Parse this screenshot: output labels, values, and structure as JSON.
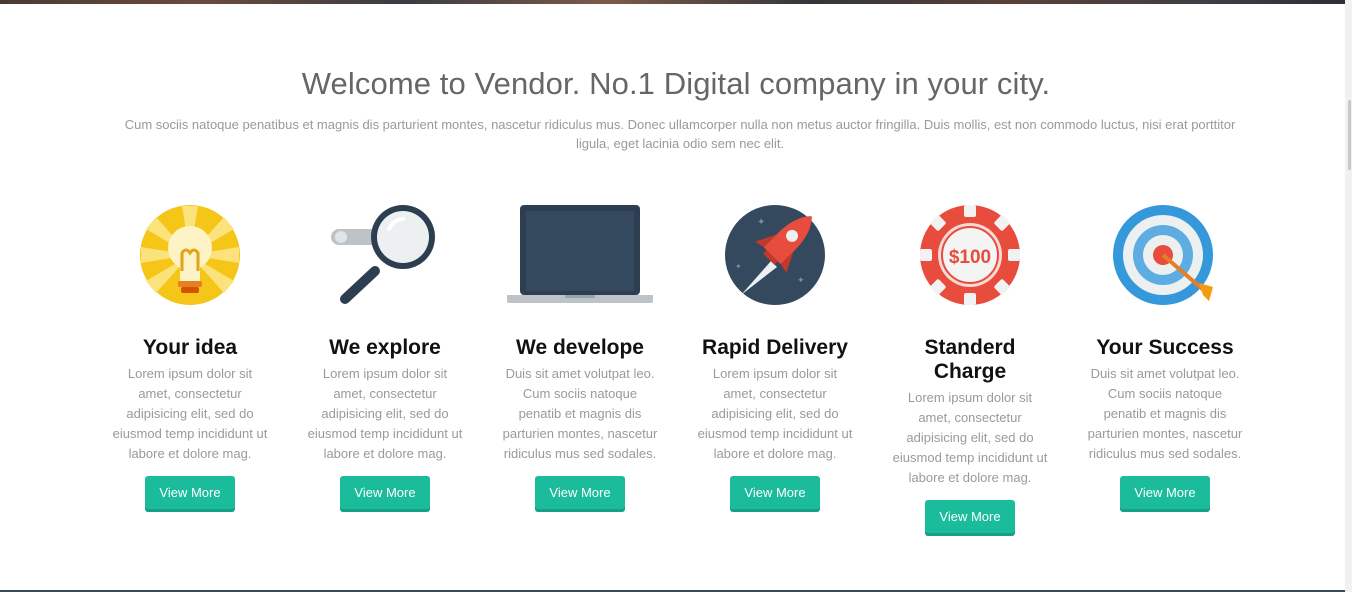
{
  "header": {
    "title": "Welcome to Vendor. No.1 Digital company in your city.",
    "intro": "Cum sociis natoque penatibus et magnis dis parturient montes, nascetur ridiculus mus. Donec ullamcorper nulla non metus auctor fringilla. Duis mollis, est non commodo luctus, nisi erat porttitor ligula, eget lacinia odio sem nec elit."
  },
  "features": [
    {
      "icon": "lightbulb-icon",
      "title": "Your idea",
      "text": "Lorem ipsum dolor sit amet, consectetur adipisicing elit, sed do eiusmod temp incididunt ut labore et dolore mag.",
      "button": "View More"
    },
    {
      "icon": "magnifier-icon",
      "title": "We explore",
      "text": "Lorem ipsum dolor sit amet, consectetur adipisicing elit, sed do eiusmod temp incididunt ut labore et dolore mag.",
      "button": "View More"
    },
    {
      "icon": "laptop-icon",
      "title": "We develope",
      "text": "Duis sit amet volutpat leo. Cum sociis natoque penatib et magnis dis parturien montes, nascetur ridiculus mus sed sodales.",
      "button": "View More"
    },
    {
      "icon": "rocket-icon",
      "title": "Rapid Delivery",
      "text": "Lorem ipsum dolor sit amet, consectetur adipisicing elit, sed do eiusmod temp incididunt ut labore et dolore mag.",
      "button": "View More"
    },
    {
      "icon": "casino-chip-icon",
      "title": "Standerd Charge",
      "chip_label": "$100",
      "text": "Lorem ipsum dolor sit amet, consectetur adipisicing elit, sed do eiusmod temp incididunt ut labore et dolore mag.",
      "button": "View More"
    },
    {
      "icon": "target-icon",
      "title": "Your Success",
      "text": "Duis sit amet volutpat leo. Cum sociis natoque penatib et magnis dis parturien montes, nascetur ridiculus mus sed sodales.",
      "button": "View More"
    }
  ],
  "colors": {
    "accent": "#1abc9c",
    "title_text": "#666666",
    "body_text": "#9a9a9a"
  }
}
